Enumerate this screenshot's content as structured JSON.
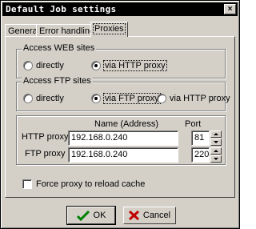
{
  "window": {
    "title": "Default Job settings",
    "close_glyph": "×"
  },
  "tabs": [
    {
      "label": "General",
      "active": false
    },
    {
      "label": "Error handling",
      "active": false
    },
    {
      "label": "Proxies",
      "active": true
    }
  ],
  "web_group": {
    "title": "Access WEB sites",
    "options": [
      {
        "label": "directly",
        "selected": false
      },
      {
        "label": "via HTTP proxy",
        "selected": true
      }
    ]
  },
  "ftp_group": {
    "title": "Access FTP sites",
    "options": [
      {
        "label": "directly",
        "selected": false
      },
      {
        "label": "via FTP proxy",
        "selected": true
      },
      {
        "label": "via HTTP proxy",
        "selected": false
      }
    ]
  },
  "proxy_table": {
    "col_name_header": "Name (Address)",
    "col_port_header": "Port",
    "rows": [
      {
        "label": "HTTP proxy",
        "address": "192.168.0.240",
        "port": "81"
      },
      {
        "label": "FTP proxy",
        "address": "192.168.0.240",
        "port": "220"
      }
    ]
  },
  "force_reload": {
    "label": "Force proxy to reload cache",
    "checked": false
  },
  "buttons": {
    "ok": {
      "label": "OK",
      "icon": "check-icon"
    },
    "cancel": {
      "label": "Cancel",
      "icon": "x-icon"
    }
  },
  "colors": {
    "face": "#d4d0c8",
    "title_bar": "#000000",
    "check": "#008000",
    "cross": "#c00000"
  }
}
